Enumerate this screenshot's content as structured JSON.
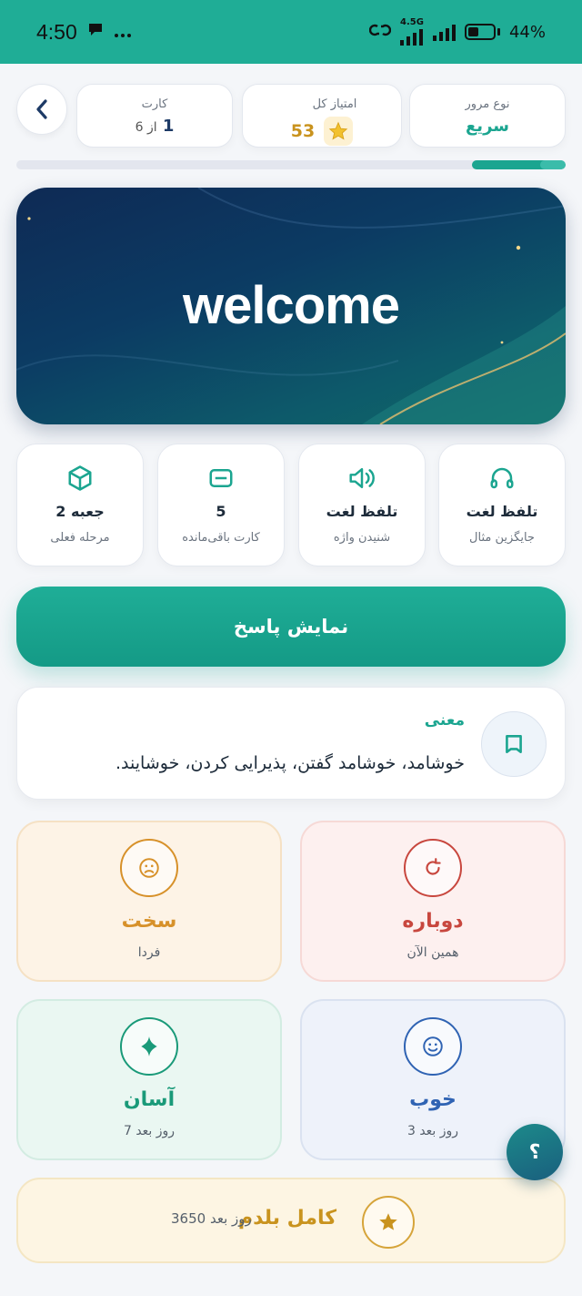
{
  "status_bar": {
    "time": "4:50",
    "network": "4.5G",
    "battery": "44%",
    "battery_level": 0.44
  },
  "header": {
    "review_type": {
      "label": "نوع مرور",
      "value": "سریع"
    },
    "total_score": {
      "label": "امتیاز کل",
      "value": "53"
    },
    "card": {
      "label": "کارت",
      "current": "1",
      "of_text": "از 6"
    },
    "progress": 0.17
  },
  "hero": {
    "word": "welcome"
  },
  "tiles": [
    {
      "title": "تلفظ لغت",
      "subtitle": "جایگزین مثال",
      "icon": "headphones-icon"
    },
    {
      "title": "تلفظ لغت",
      "subtitle": "شنیدن واژه",
      "icon": "speaker-icon"
    },
    {
      "title": "5",
      "subtitle": "کارت باقی‌مانده",
      "icon": "card-icon"
    },
    {
      "title": "جعبه 2",
      "subtitle": "مرحله فعلی",
      "icon": "box-icon"
    }
  ],
  "reveal_button": "نمایش پاسخ",
  "meaning": {
    "title": "معنی",
    "text": "خوشامد، خوشامد گفتن، پذیرایی کردن، خوشایند."
  },
  "ratings": {
    "again": {
      "title": "دوباره",
      "subtitle": "همین الآن",
      "color": "#c8473e"
    },
    "hard": {
      "title": "سخت",
      "subtitle": "فردا",
      "color": "#d7912a"
    },
    "good": {
      "title": "خوب",
      "subtitle": "3 روز بعد",
      "color": "#2f63b3"
    },
    "easy": {
      "title": "آسان",
      "subtitle": "7 روز بعد",
      "color": "#1a9a79"
    }
  },
  "mastered": {
    "title": "کامل بلدم",
    "subtitle": "3650 روز بعد"
  },
  "help_button": "؟",
  "colors": {
    "accent": "#1ba590",
    "gold": "#c9931e"
  }
}
